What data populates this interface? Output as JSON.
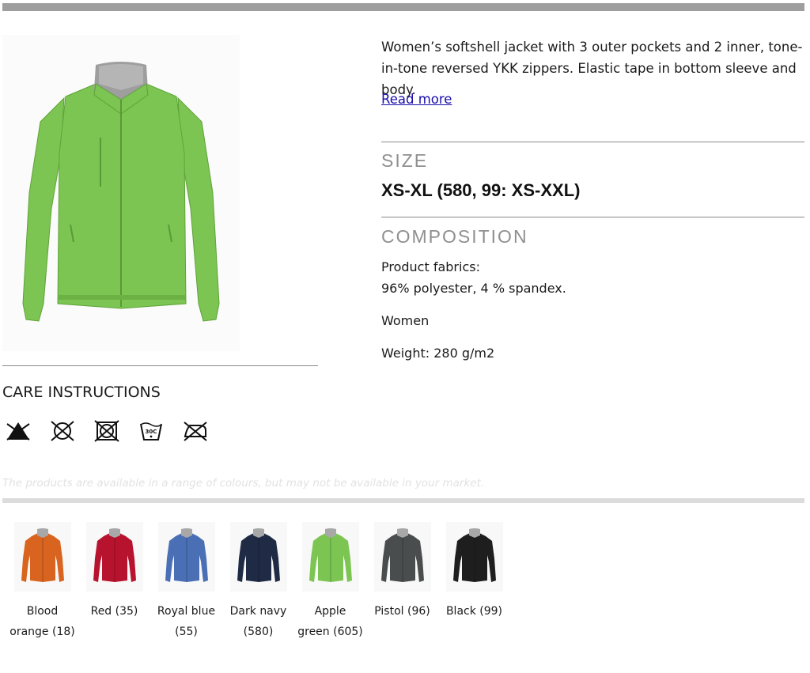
{
  "product": {
    "description": "Women’s softshell jacket with 3 outer pockets and 2 inner, tone-in-tone reversed YKK zippers. Elastic tape in bottom sleeve and body.",
    "read_more": "Read more",
    "main_color": "#7cc552"
  },
  "size": {
    "title": "SIZE",
    "value": "XS-XL (580, 99: XS-XXL)"
  },
  "composition": {
    "title": "COMPOSITION",
    "fabrics_label": "Product fabrics:",
    "fabrics_value": "96% polyester, 4 % spandex.",
    "gender": "Women",
    "weight": "Weight: 280 g/m2"
  },
  "care": {
    "title": "CARE INSTRUCTIONS",
    "icons": [
      "do-not-bleach-icon",
      "do-not-dry-clean-icon",
      "do-not-tumble-dry-icon",
      "wash-30c-icon",
      "do-not-iron-icon"
    ],
    "wash_temp": "30C"
  },
  "availability_note": "The products are available in a range of colours, but may not be available in your market.",
  "colors": [
    {
      "label": "Blood orange (18)",
      "hex": "#d8641f"
    },
    {
      "label": "Red (35)",
      "hex": "#b8132e"
    },
    {
      "label": "Royal blue (55)",
      "hex": "#4a6fb5"
    },
    {
      "label": "Dark navy (580)",
      "hex": "#1f2a44"
    },
    {
      "label": "Apple green (605)",
      "hex": "#7cc552"
    },
    {
      "label": "Pistol (96)",
      "hex": "#4a4d4d"
    },
    {
      "label": "Black (99)",
      "hex": "#1e1e1e"
    }
  ]
}
